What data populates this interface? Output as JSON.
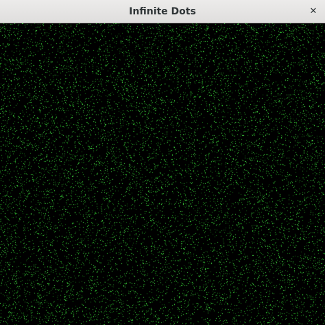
{
  "window": {
    "title": "Infinite Dots",
    "close_icon": "close-icon"
  },
  "canvas": {
    "background_color": "#000000",
    "dot_colors": [
      "#1f8f1f",
      "#2bb52b",
      "#39d439",
      "#4ef04e",
      "#166b16"
    ]
  },
  "colors": {
    "titlebar": "#e8e7e6",
    "title_text": "#2e3436"
  }
}
